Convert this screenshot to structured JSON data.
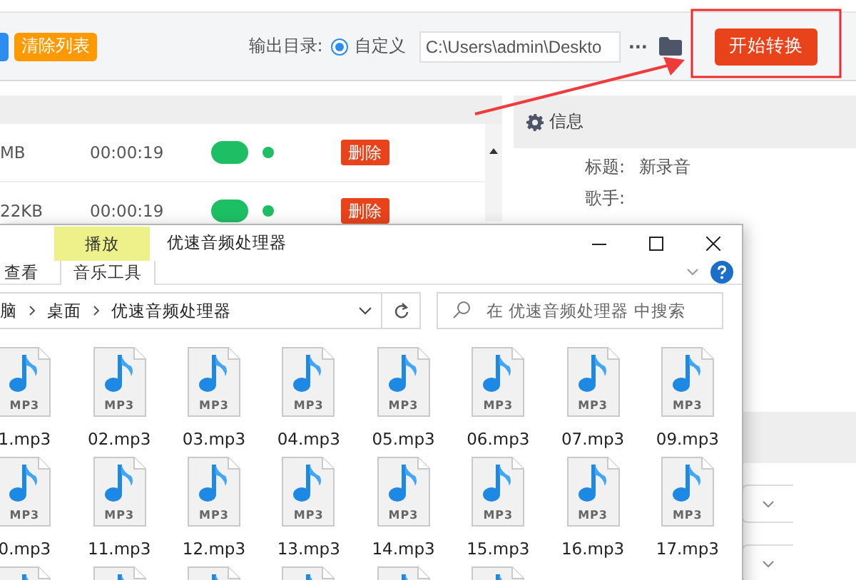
{
  "toolbar": {
    "clear_button": "清除列表",
    "output_label": "输出目录:",
    "output_option": {
      "label": "自定义",
      "selected": true
    },
    "output_path": "C:\\Users\\admin\\Deskto",
    "more_button": "···",
    "start_button": "开始转换"
  },
  "file_rows": [
    {
      "size": "MB",
      "duration": "00:00:19",
      "on": true,
      "done": true,
      "delete_button": "删除"
    },
    {
      "size": "22KB",
      "duration": "00:00:19",
      "on": true,
      "done": true,
      "delete_button": "删除"
    }
  ],
  "info": {
    "title": "信息",
    "fields": [
      {
        "label": "标题:",
        "value": "新录音"
      },
      {
        "label": "歌手:"
      }
    ]
  },
  "explorer": {
    "context_tab": "播放",
    "title": "优速音频处理器",
    "ribbon_tabs": [
      {
        "label": "查看",
        "selected": false
      },
      {
        "label": "音乐工具",
        "selected": true
      }
    ],
    "breadcrumb": [
      "脑",
      "桌面",
      "优速音频处理器"
    ],
    "search": {
      "placeholder": "在 优速音频处理器 中搜索"
    },
    "files": [
      {
        "kind": "file",
        "badge": "MP3",
        "name": "1.mp3"
      },
      {
        "kind": "file",
        "badge": "MP3",
        "name": "02.mp3"
      },
      {
        "kind": "file",
        "badge": "MP3",
        "name": "03.mp3"
      },
      {
        "kind": "file",
        "badge": "MP3",
        "name": "04.mp3"
      },
      {
        "kind": "file",
        "badge": "MP3",
        "name": "05.mp3"
      },
      {
        "kind": "file",
        "badge": "MP3",
        "name": "06.mp3"
      },
      {
        "kind": "file",
        "badge": "MP3",
        "name": "07.mp3"
      },
      {
        "kind": "file",
        "badge": "MP3",
        "name": "09.mp3"
      },
      {
        "kind": "file",
        "badge": "MP3",
        "name": "0.mp3"
      },
      {
        "kind": "file",
        "badge": "MP3",
        "name": "11.mp3"
      },
      {
        "kind": "file",
        "badge": "MP3",
        "name": "12.mp3"
      },
      {
        "kind": "file",
        "badge": "MP3",
        "name": "13.mp3"
      },
      {
        "kind": "file",
        "badge": "MP3",
        "name": "14.mp3"
      },
      {
        "kind": "file",
        "badge": "MP3",
        "name": "15.mp3"
      },
      {
        "kind": "file",
        "badge": "MP3",
        "name": "16.mp3"
      },
      {
        "kind": "file",
        "badge": "MP3",
        "name": "17.mp3"
      },
      {
        "kind": "cut-off"
      },
      {
        "kind": "cut-off"
      },
      {
        "kind": "cut-off"
      },
      {
        "kind": "cut-off"
      },
      {
        "kind": "cut-off"
      },
      {
        "kind": "cut-off"
      }
    ]
  }
}
